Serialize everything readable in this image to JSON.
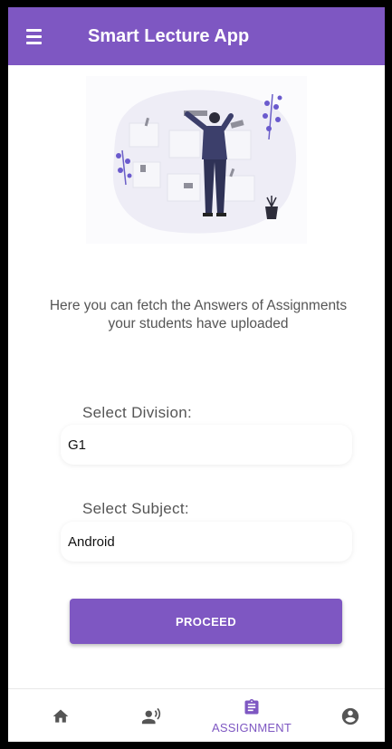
{
  "app_bar": {
    "title": "Smart Lecture App",
    "menu_icon": "hamburger-menu-icon"
  },
  "main": {
    "description": "Here you can fetch the Answers of Assignments your students have uploaded",
    "division": {
      "label": "Select Division:",
      "value": "G1"
    },
    "subject": {
      "label": "Select Subject:",
      "value": "Android"
    },
    "proceed_label": "PROCEED"
  },
  "bottom_nav": {
    "items": [
      {
        "icon": "home-icon",
        "label": "",
        "active": false
      },
      {
        "icon": "record-voice-icon",
        "label": "",
        "active": false
      },
      {
        "icon": "assignment-icon",
        "label": "ASSIGNMENT",
        "active": true
      },
      {
        "icon": "account-circle-icon",
        "label": "",
        "active": false
      }
    ]
  },
  "colors": {
    "primary": "#7e57c2",
    "text_gray": "#555555",
    "illustration_accent": "#6a5acd"
  }
}
